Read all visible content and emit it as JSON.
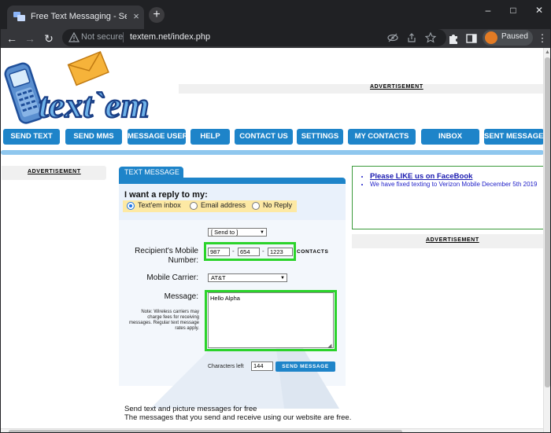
{
  "browser": {
    "tab_title": "Free Text Messaging - Send and Receive",
    "tab_close": "×",
    "new_tab": "+",
    "window_controls": {
      "minimize": "–",
      "maximize": "□",
      "close": "✕"
    },
    "not_secure": "Not secure",
    "url": "textem.net/index.php",
    "profile_status": "Paused",
    "nav_back": "←",
    "nav_forward": "→",
    "nav_reload": "↻"
  },
  "site": {
    "logo_text": "text`em",
    "ad_label": "ADVERTISEMENT",
    "nav": [
      "SEND TEXT",
      "SEND MMS",
      "MESSAGE USER",
      "HELP",
      "CONTACT US",
      "SETTINGS",
      "MY CONTACTS",
      "INBOX",
      "SENT MESSAGES"
    ]
  },
  "form": {
    "tab_label": "TEXT MESSAGE",
    "reply_title": "I want a reply to my:",
    "reply_options": [
      "Text'em inbox",
      "Email address",
      "No Reply"
    ],
    "selected_reply": "Text'em inbox",
    "send_to": "[ Send to ]",
    "recipient_label_1": "Recipient's Mobile",
    "recipient_label_2": "Number:",
    "phone": [
      "987",
      "654",
      "1223"
    ],
    "phone_dash": "-",
    "contacts_link": "CONTACTS",
    "carrier_label": "Mobile Carrier:",
    "carrier_value": "AT&T",
    "message_label": "Message:",
    "message_value": "Hello Alpha",
    "note": "Note: Wireless carriers may charge fees for receiving messages. Regular text message rates apply.",
    "chars_left_label": "Characters left",
    "chars_left_value": "144",
    "send_button": "SEND MESSAGE"
  },
  "news": {
    "items": [
      {
        "text": "Please LIKE us on FaceBook",
        "link": true
      },
      {
        "text": "We have fixed texting to Verizon Mobile December 5th 2019",
        "link": false
      }
    ]
  },
  "footer": {
    "title": "Send text and picture messages for free",
    "text": "The messages that you send and receive using our website are free."
  },
  "colors": {
    "nav_blue": "#1e84c9",
    "highlight_green": "#2bd32b",
    "reply_bar": "#fde9a4",
    "news_border": "#3a9a3a"
  }
}
